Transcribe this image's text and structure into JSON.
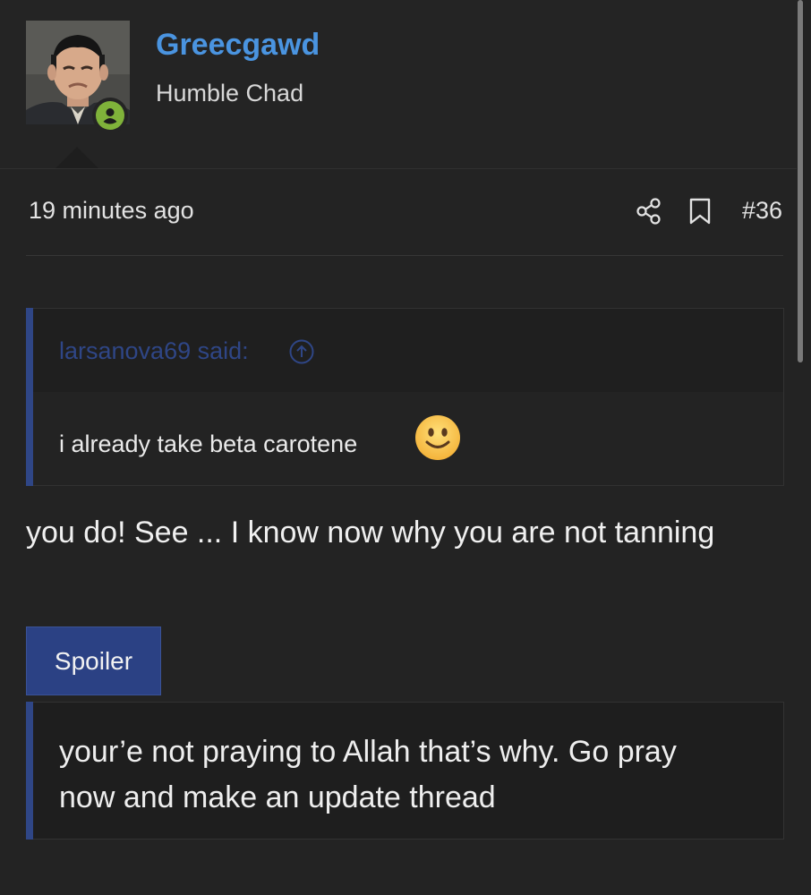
{
  "user": {
    "name": "Greecgawd",
    "title": "Humble Chad",
    "status": "online",
    "accent_color": "#4a94e0",
    "online_color": "#7fb23a"
  },
  "message": {
    "timestamp": "19 minutes ago",
    "post_number": "#36",
    "icons": [
      "share-icon",
      "bookmark-icon"
    ]
  },
  "quote": {
    "attribution": "larsanova69 said:",
    "attribution_icon": "arrow-up-circle-icon",
    "body": "i already take beta carotene",
    "emoji": "slightly-smiling-face-icon"
  },
  "reply": {
    "text": "you do! See ... I know now why you are not tanning"
  },
  "spoiler": {
    "button_label": "Spoiler",
    "content": "your’e not praying to Allah that’s why. Go pray now and make an update thread",
    "accent_color": "#2b4184"
  }
}
